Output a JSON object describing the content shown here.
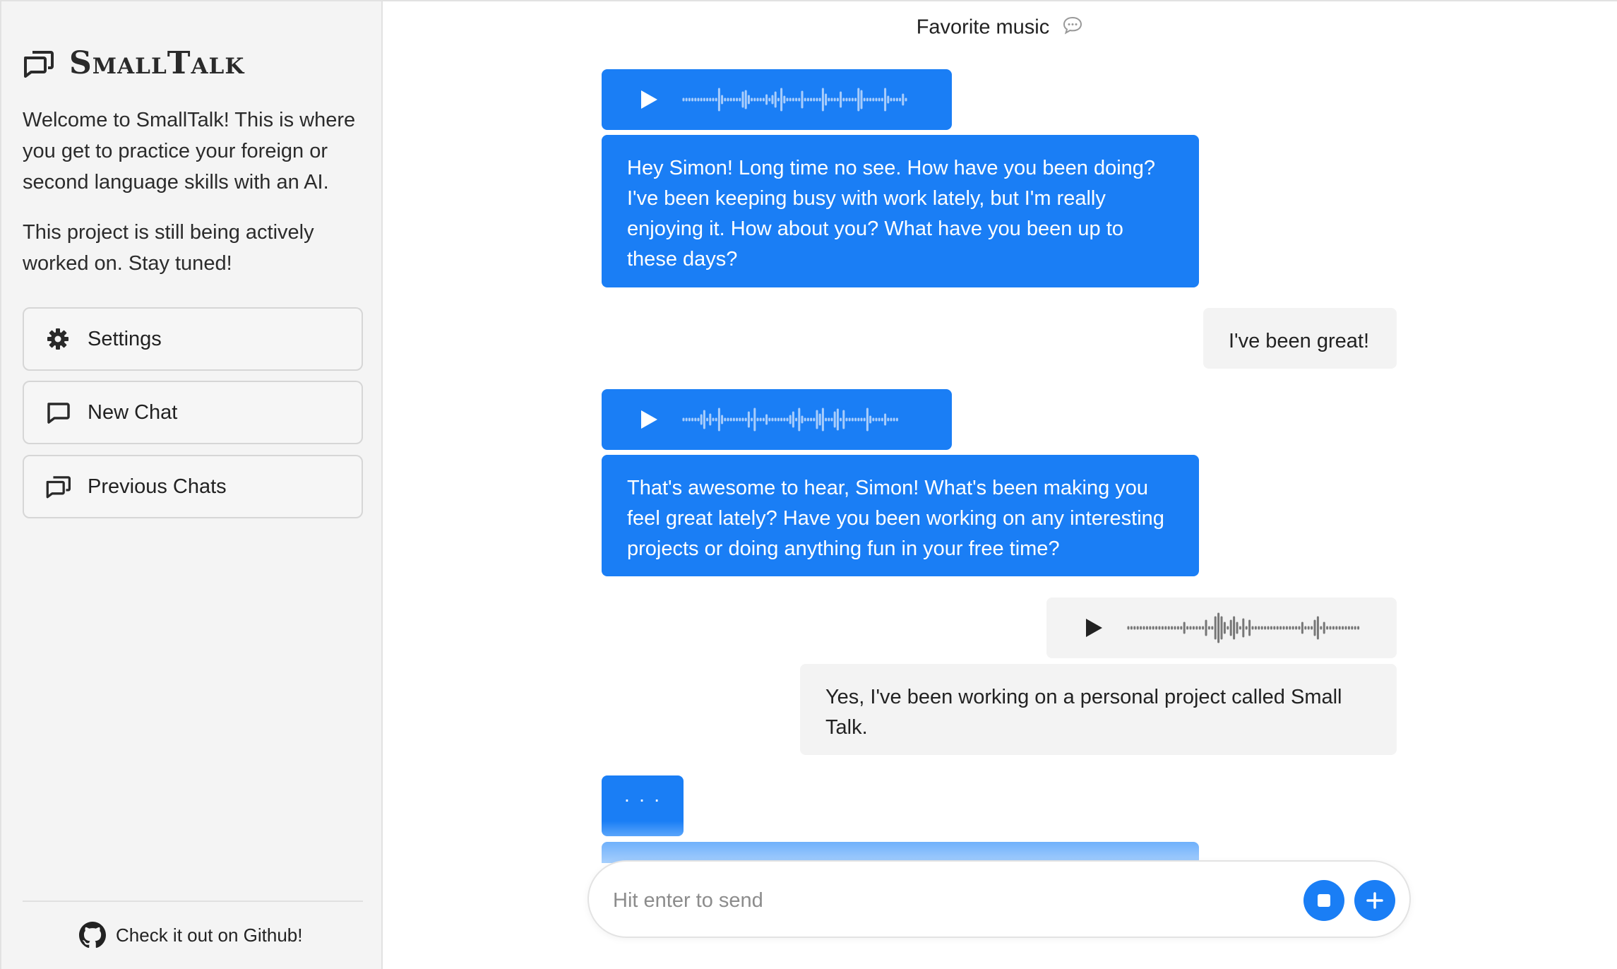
{
  "sidebar": {
    "brand": "SmallTalk",
    "intro": [
      "Welcome to SmallTalk! This is where you get to practice your foreign or second language skills with an AI.",
      "This project is still being actively worked on. Stay tuned!"
    ],
    "buttons": {
      "settings": "Settings",
      "new_chat": "New Chat",
      "previous_chats": "Previous Chats"
    },
    "github": "Check it out on Github!"
  },
  "chat": {
    "title": "Favorite music",
    "messages": [
      {
        "role": "assistant",
        "text": "Hey Simon! Long time no see. How have you been doing? I've been keeping busy with work lately, but I'm really enjoying it. How about you? What have you been up to these days?"
      },
      {
        "role": "user",
        "text": "I've been great!"
      },
      {
        "role": "assistant",
        "text": "That's awesome to hear, Simon! What's been making you feel great lately? Have you been working on any interesting projects or doing anything fun in your free time?"
      },
      {
        "role": "user",
        "text": "Yes, I've been working on a personal project called Small Talk."
      }
    ],
    "typing_indicator": "· · ·"
  },
  "composer": {
    "placeholder": "Hit enter to send"
  },
  "icons": {
    "brand": "chats-icon",
    "settings": "gear-icon",
    "new_chat": "chat-bubble-icon",
    "previous_chats": "chats-icon",
    "github": "github-icon",
    "title": "speech-bubble-icon",
    "play": "play-icon",
    "stop": "stop-icon",
    "add": "plus-icon"
  },
  "colors": {
    "accent": "#1a7ef5",
    "sidebar_bg": "#f4f4f4",
    "user_bubble": "#f3f3f3"
  }
}
